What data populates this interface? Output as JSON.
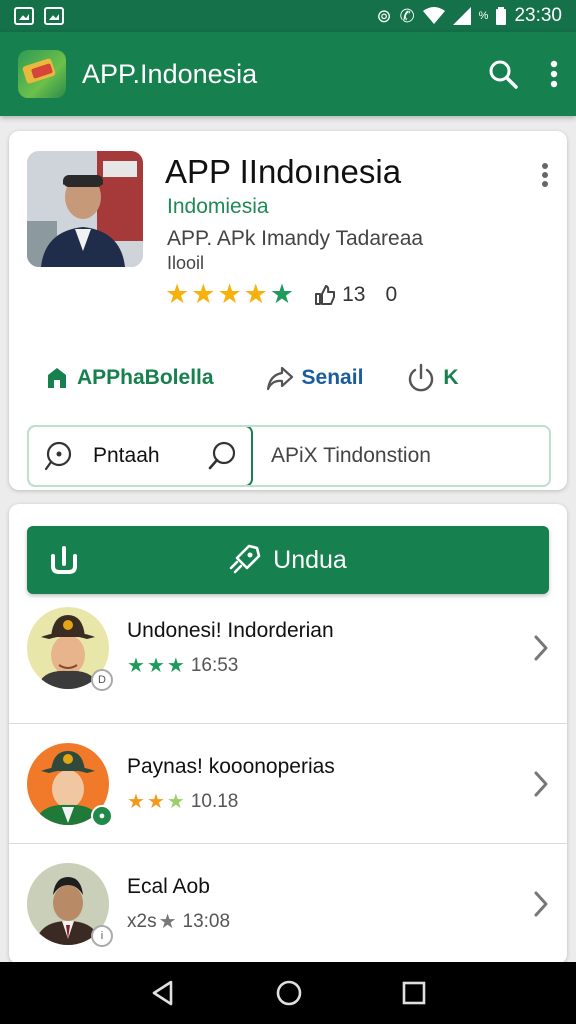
{
  "status_bar": {
    "time": "23:30",
    "battery_text": "%"
  },
  "app_bar": {
    "title": "APP.Indonesia"
  },
  "app_card": {
    "title": "APP IIndoınesia",
    "subtitle": "Indomiesia",
    "developer": "APP. APk Imandy Tadareaa",
    "extra": "Ilooil",
    "rating_stars": 5,
    "likes": "13",
    "zero_count": "0",
    "action_home": "APPhaBolella",
    "action_send": "Senail",
    "action_k": "K",
    "search_left_label": "Pntaah",
    "search_right_text": "APiX Tindonstion"
  },
  "download_button": {
    "label": "Undua"
  },
  "list": [
    {
      "title": "Undonesi! Indorderian",
      "stars": 3,
      "value": "16:53",
      "star_color": "#1f9a5c",
      "avatar_bg": "#e8e6a8"
    },
    {
      "title": "Paynas! kooonoperias",
      "stars": 3,
      "value": "10.18",
      "star_color": "#f39a1c",
      "avatar_bg": "#f07a2a"
    },
    {
      "title": "Ecal Aob",
      "stars": 1,
      "prefix": "x2s",
      "value": "13:08",
      "star_color": "#777777",
      "avatar_bg": "#d9dcc6"
    }
  ],
  "colors": {
    "primary": "#17804f",
    "accent_yellow": "#f6b10c",
    "accent_teal": "#1f9a5c"
  }
}
